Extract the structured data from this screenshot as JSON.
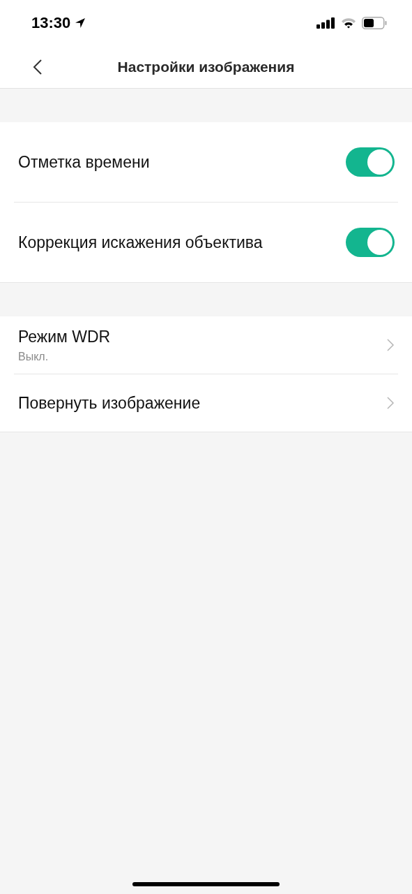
{
  "status_bar": {
    "time": "13:30"
  },
  "nav": {
    "title": "Настройки изображения"
  },
  "sections": [
    {
      "items": [
        {
          "kind": "toggle",
          "label": "Отметка времени",
          "on": true
        },
        {
          "kind": "toggle",
          "label": "Коррекция искажения объектива",
          "on": true
        }
      ]
    },
    {
      "items": [
        {
          "kind": "link",
          "label": "Режим WDR",
          "value": "Выкл."
        },
        {
          "kind": "link",
          "label": "Повернуть изображение"
        }
      ]
    }
  ]
}
